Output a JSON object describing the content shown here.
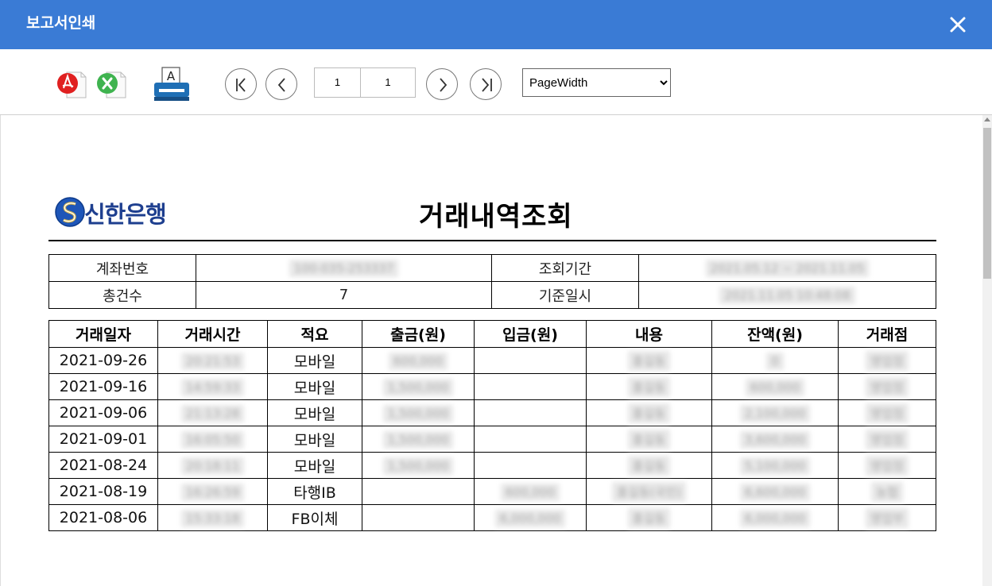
{
  "window": {
    "title": "보고서인쇄"
  },
  "toolbar": {
    "page_current": "1",
    "page_total": "1",
    "zoom_selected": "PageWidth",
    "print_glyph": "A"
  },
  "report": {
    "bank_name": "신한은행",
    "title": "거래내역조회",
    "info": {
      "account_label": "계좌번호",
      "account_value": "100-035-253337",
      "period_label": "조회기간",
      "period_value": "2021.05.12 ~ 2021.11.05",
      "count_label": "총건수",
      "count_value": "7",
      "basedate_label": "기준일시",
      "basedate_value": "2021.11.05 10:48:08"
    },
    "columns": [
      "거래일자",
      "거래시간",
      "적요",
      "출금(원)",
      "입금(원)",
      "내용",
      "잔액(원)",
      "거래점"
    ],
    "rows": [
      [
        "2021-09-26",
        "20:21:53",
        "모바일",
        "600,000",
        "",
        "홍길동",
        "0",
        "영업점"
      ],
      [
        "2021-09-16",
        "14:59:33",
        "모바일",
        "1,500,000",
        "",
        "홍길동",
        "600,000",
        "영업점"
      ],
      [
        "2021-09-06",
        "21:13:28",
        "모바일",
        "1,500,000",
        "",
        "홍길동",
        "2,100,000",
        "영업점"
      ],
      [
        "2021-09-01",
        "16:05:50",
        "모바일",
        "1,500,000",
        "",
        "홍길동",
        "3,600,000",
        "영업점"
      ],
      [
        "2021-08-24",
        "20:18:11",
        "모바일",
        "1,500,000",
        "",
        "홍길동",
        "5,100,000",
        "영업점"
      ],
      [
        "2021-08-19",
        "16:26:59",
        "타행IB",
        "",
        "600,000",
        "홍길동(국민)",
        "6,600,000",
        "농협"
      ],
      [
        "2021-08-06",
        "15:33:18",
        "FB이체",
        "",
        "6,000,000",
        "홍길동",
        "6,000,000",
        "영업부"
      ]
    ]
  },
  "colors": {
    "titlebar": "#3a7bd5",
    "bank_blue": "#1e3f8f",
    "pdf_red": "#e02020",
    "excel_green": "#3fb34f",
    "printer_blue": "#1f6fb5"
  },
  "icons": [
    "close-icon",
    "pdf-icon",
    "excel-icon",
    "printer-icon",
    "first-page-icon",
    "prev-page-icon",
    "next-page-icon",
    "last-page-icon",
    "shinhan-logo"
  ]
}
